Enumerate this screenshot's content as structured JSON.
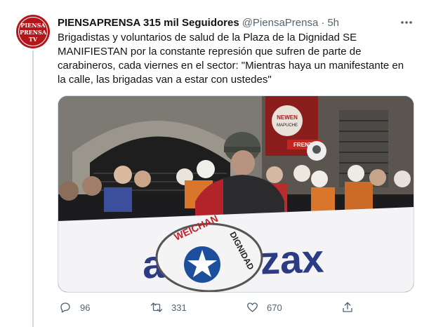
{
  "tweet": {
    "author": {
      "display_name": "PIENSAPRENSA 315 mil Seguidores",
      "handle": "@PiensaPrensa",
      "separator": "·",
      "time": "5h",
      "avatar_text": [
        "PIENSA",
        "PRENSA",
        "TV"
      ]
    },
    "text": "Brigadistas y voluntarios de salud de la Plaza de la Dignidad SE MANIFIESTAN por la constante represión que sufren de parte de carabineros, cada viernes en el sector: \"Mientras haya un manifestante en la calle, las brigadas van a estar con ustedes\"",
    "media": {
      "sign_text": [
        "NEWEN",
        "MAPUCHE"
      ],
      "sign2_text": "FRENTE",
      "banner_text": "al    fuerzax",
      "shield_text": [
        "WEICHAN",
        "DIGNIDAD"
      ]
    },
    "actions": {
      "replies": "96",
      "retweets": "331",
      "likes": "670"
    },
    "icons": {
      "more": "more-icon",
      "reply": "reply-icon",
      "retweet": "retweet-icon",
      "like": "like-icon",
      "share": "share-icon"
    },
    "colors": {
      "avatar_bg": "#b3151b",
      "meta_gray": "#536471",
      "text": "#0f1419",
      "border": "#cfd9de"
    }
  }
}
